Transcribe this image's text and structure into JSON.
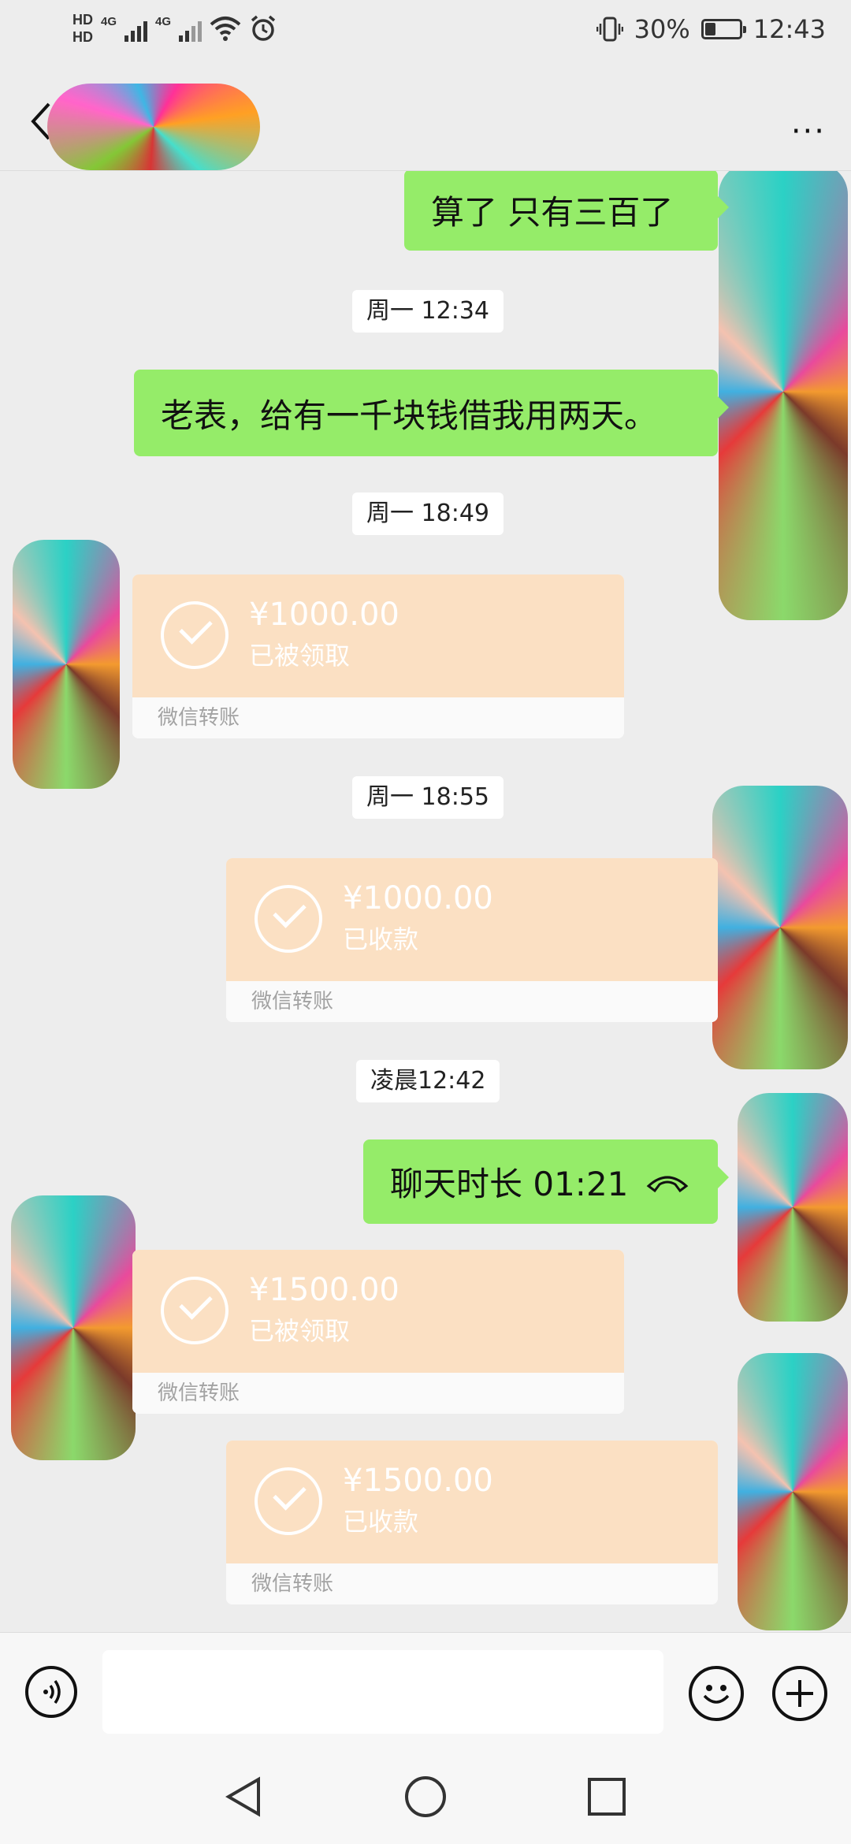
{
  "status_bar": {
    "hd1": "HD",
    "hd2": "HD",
    "sim1": "4G",
    "sim2": "4G",
    "battery": "30%",
    "time": "12:43",
    "icons": [
      "vibrate-icon",
      "battery-icon",
      "wifi-icon",
      "alarm-icon"
    ]
  },
  "header": {
    "back_icon": "chevron-left-icon",
    "more_icon": "more-dots-icon",
    "more_label": "···"
  },
  "messages": {
    "m1": {
      "text": "算了 只有三百了"
    },
    "ts1": "周一 12:34",
    "m2": {
      "text": "老表，给有一千块钱借我用两天。"
    },
    "ts2": "周一 18:49",
    "t1": {
      "amount": "¥1000.00",
      "status": "已被领取",
      "label": "微信转账"
    },
    "ts3": "周一 18:55",
    "t2": {
      "amount": "¥1000.00",
      "status": "已收款",
      "label": "微信转账"
    },
    "ts4": "凌晨12:42",
    "m3": {
      "text": "聊天时长 01:21"
    },
    "t3": {
      "amount": "¥1500.00",
      "status": "已被领取",
      "label": "微信转账"
    },
    "t4": {
      "amount": "¥1500.00",
      "status": "已收款",
      "label": "微信转账"
    }
  },
  "input_bar": {
    "voice_icon": "voice-icon",
    "emoji_icon": "emoji-icon",
    "plus_icon": "plus-icon"
  },
  "nav_bar": {
    "back": "triangle-back-icon",
    "home": "circle-home-icon",
    "recent": "square-recent-icon"
  },
  "colors": {
    "background": "#ededed",
    "green_bubble": "#95ec69",
    "transfer": "#fbe0c3"
  }
}
